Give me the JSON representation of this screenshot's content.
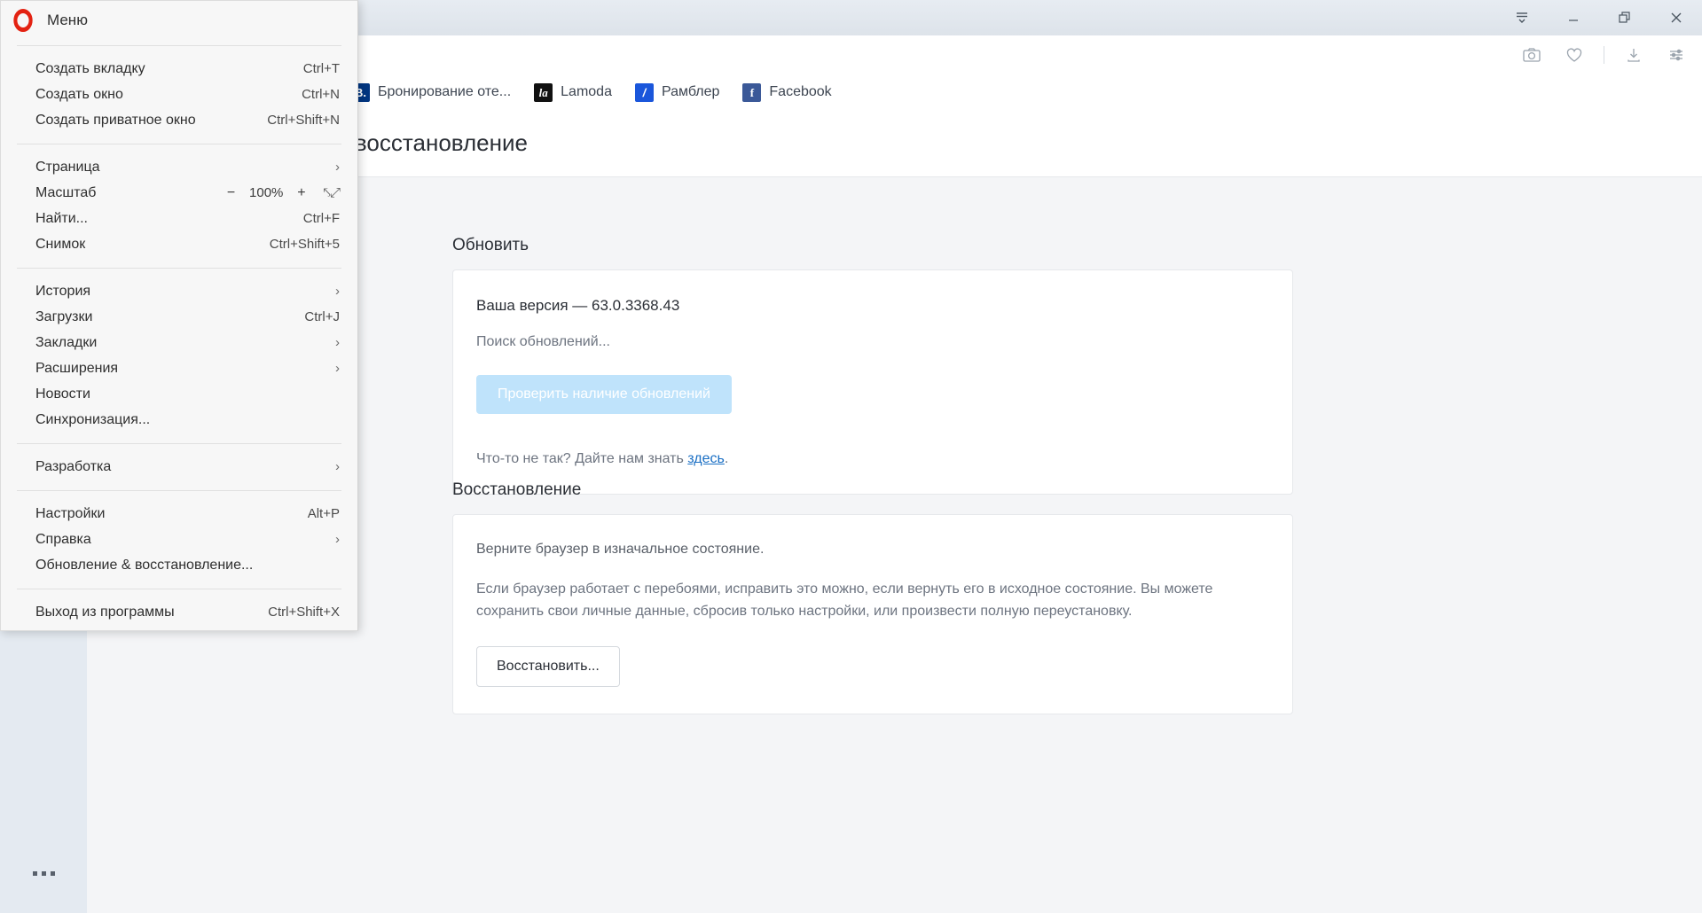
{
  "window": {
    "controls": [
      {
        "name": "tab-menu",
        "glyph": "☰"
      },
      {
        "name": "minimize",
        "glyph": "—"
      },
      {
        "name": "restore",
        "glyph": "❐"
      },
      {
        "name": "close",
        "glyph": "✕"
      }
    ]
  },
  "toolbar": {
    "icons": [
      {
        "name": "snapshot-icon",
        "glyph": "📷"
      },
      {
        "name": "heart-icon",
        "glyph": "♡"
      },
      {
        "name": "downloads-icon",
        "glyph": "⤓"
      },
      {
        "name": "easy-setup-icon",
        "glyph": "≡"
      }
    ]
  },
  "bookmarks": {
    "items": [
      {
        "label": "Бронирование оте...",
        "favicon": "B.",
        "favclass": "fav-booking"
      },
      {
        "label": "Lamoda",
        "favicon": "la",
        "favclass": "fav-lamoda"
      },
      {
        "label": "Рамблер",
        "favicon": "/",
        "favclass": "fav-rambler"
      },
      {
        "label": "Facebook",
        "favicon": "f",
        "favclass": "fav-facebook"
      }
    ]
  },
  "page": {
    "title": "Обновление & восстановление",
    "update": {
      "section_title": "Обновить",
      "version_line": "Ваша версия — 63.0.3368.43",
      "status": "Поиск обновлений...",
      "check_button": "Проверить наличие обновлений",
      "hint_prefix": "Что-то не так? Дайте нам знать ",
      "hint_link": "здесь",
      "hint_suffix": "."
    },
    "recovery": {
      "section_title": "Восстановление",
      "lead": "Верните браузер в изначальное состояние.",
      "body": "Если браузер работает с перебоями, исправить это можно, если вернуть его в исходное состояние. Вы можете сохранить свои личные данные, сбросив только настройки, или произвести полную переустановку.",
      "button": "Восстановить..."
    }
  },
  "opera_menu": {
    "header": "Меню",
    "groups": [
      {
        "items": [
          {
            "label": "Создать вкладку",
            "accel": "Ctrl+T",
            "submenu": false
          },
          {
            "label": "Создать окно",
            "accel": "Ctrl+N",
            "submenu": false
          },
          {
            "label": "Создать приватное окно",
            "accel": "Ctrl+Shift+N",
            "submenu": false
          }
        ]
      },
      {
        "items": [
          {
            "label": "Страница",
            "accel": "",
            "submenu": true
          },
          {
            "label": "Масштаб",
            "accel": "",
            "submenu": false,
            "zoom": true
          },
          {
            "label": "Найти...",
            "accel": "Ctrl+F",
            "submenu": false
          },
          {
            "label": "Снимок",
            "accel": "Ctrl+Shift+5",
            "submenu": false
          }
        ]
      },
      {
        "items": [
          {
            "label": "История",
            "accel": "",
            "submenu": true
          },
          {
            "label": "Загрузки",
            "accel": "Ctrl+J",
            "submenu": false
          },
          {
            "label": "Закладки",
            "accel": "",
            "submenu": true
          },
          {
            "label": "Расширения",
            "accel": "",
            "submenu": true
          },
          {
            "label": "Новости",
            "accel": "",
            "submenu": false
          },
          {
            "label": "Синхронизация...",
            "accel": "",
            "submenu": false
          }
        ]
      },
      {
        "items": [
          {
            "label": "Разработка",
            "accel": "",
            "submenu": true
          }
        ]
      },
      {
        "items": [
          {
            "label": "Настройки",
            "accel": "Alt+P",
            "submenu": false
          },
          {
            "label": "Справка",
            "accel": "",
            "submenu": true
          },
          {
            "label": "Обновление & восстановление...",
            "accel": "",
            "submenu": false
          }
        ]
      },
      {
        "items": [
          {
            "label": "Выход из программы",
            "accel": "Ctrl+Shift+X",
            "submenu": false
          }
        ]
      }
    ],
    "zoom": {
      "minus": "−",
      "value": "100%",
      "plus": "+",
      "fullscreen": "⤣⤢"
    }
  },
  "colors": {
    "opera_red": "#e32212",
    "accent_link": "#1a6fc4",
    "button_disabled": "#bfe3fb",
    "sidebar": "#e4eaf1",
    "content_bg": "#f4f5f7"
  }
}
